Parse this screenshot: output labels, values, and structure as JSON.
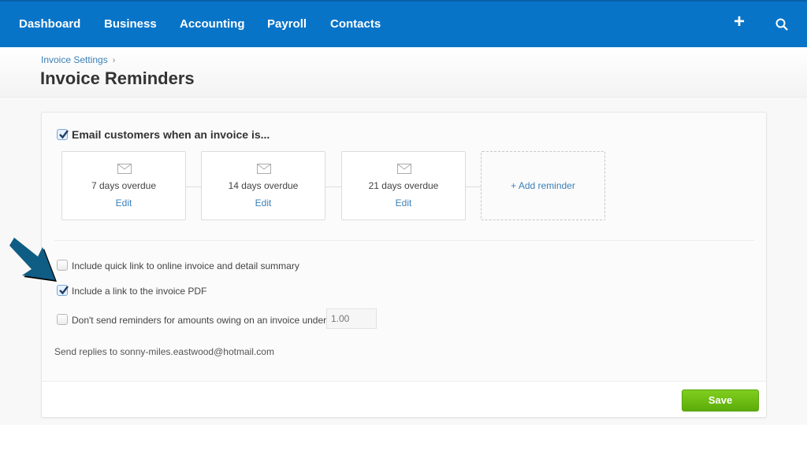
{
  "nav": {
    "items": [
      {
        "label": "Dashboard"
      },
      {
        "label": "Business"
      },
      {
        "label": "Accounting"
      },
      {
        "label": "Payroll"
      },
      {
        "label": "Contacts"
      }
    ],
    "plus_icon": "+",
    "search_icon": "search-icon"
  },
  "header": {
    "breadcrumb": "Invoice Settings",
    "breadcrumb_sep": "›",
    "title": "Invoice Reminders"
  },
  "reminders": {
    "enabled": true,
    "heading": "Email customers when an invoice is...",
    "items": [
      {
        "label": "7 days overdue",
        "edit": "Edit"
      },
      {
        "label": "14 days overdue",
        "edit": "Edit"
      },
      {
        "label": "21 days overdue",
        "edit": "Edit"
      }
    ],
    "add_label": "+ Add reminder"
  },
  "options": {
    "quick_link": {
      "label": "Include quick link to online invoice and detail summary",
      "checked": false
    },
    "pdf_link": {
      "label": "Include a link to the invoice PDF",
      "checked": true
    },
    "min_amount": {
      "label": "Don't send reminders for amounts owing on an invoice under",
      "checked": false,
      "placeholder": "1.00"
    }
  },
  "replies": "Send replies to sonny-miles.eastwood@hotmail.com",
  "footer": {
    "save_label": "Save"
  },
  "colors": {
    "nav": "#0874c8",
    "link": "#3b80b8",
    "save": "#6cbd14",
    "annotation_arrow": "#0f5d85"
  }
}
